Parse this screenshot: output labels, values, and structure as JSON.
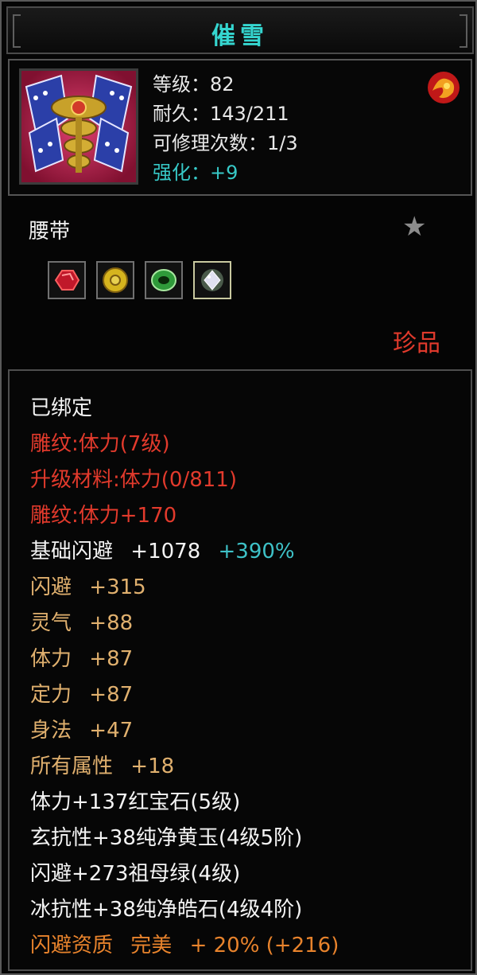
{
  "title": "催雪",
  "header": {
    "level": "等级：82",
    "durability": "耐久：143/211",
    "repair_count": "可修理次数：1/3",
    "enhance": "强化：+9"
  },
  "item_type": "腰带",
  "rarity": "珍品",
  "gems": [
    {
      "icon": "ruby-gem-icon",
      "color": "#c0182a"
    },
    {
      "icon": "yellow-jade-gem-icon",
      "color": "#d6b41e"
    },
    {
      "icon": "emerald-gem-icon",
      "color": "#2f9a3a"
    },
    {
      "icon": "diamond-gem-icon",
      "color": "#c8c8d8"
    }
  ],
  "attributes": {
    "bound": "已绑定",
    "carve_level": "雕纹:体力(7级)",
    "upgrade_material": "升级材料:体力(0/811)",
    "carve_bonus": "雕纹:体力+170",
    "base_dodge_label": "基础闪避",
    "base_dodge_value": "+1078",
    "base_dodge_pct": "+390%",
    "dodge_label": "闪避",
    "dodge_value": "+315",
    "spirit_label": "灵气",
    "spirit_value": "+88",
    "stamina_label": "体力",
    "stamina_value": "+87",
    "focus_label": "定力",
    "focus_value": "+87",
    "agility_label": "身法",
    "agility_value": "+47",
    "all_attr_label": "所有属性",
    "all_attr_value": "+18",
    "gem_line_1": "体力+137红宝石(5级)",
    "gem_line_2": "玄抗性+38纯净黄玉(4级5阶)",
    "gem_line_3": "闪避+273祖母绿(4级)",
    "gem_line_4": "冰抗性+38纯净皓石(4级4阶)",
    "quality_label": "闪避资质",
    "quality_grade": "完美",
    "quality_value": "+ 20% (+216)"
  }
}
